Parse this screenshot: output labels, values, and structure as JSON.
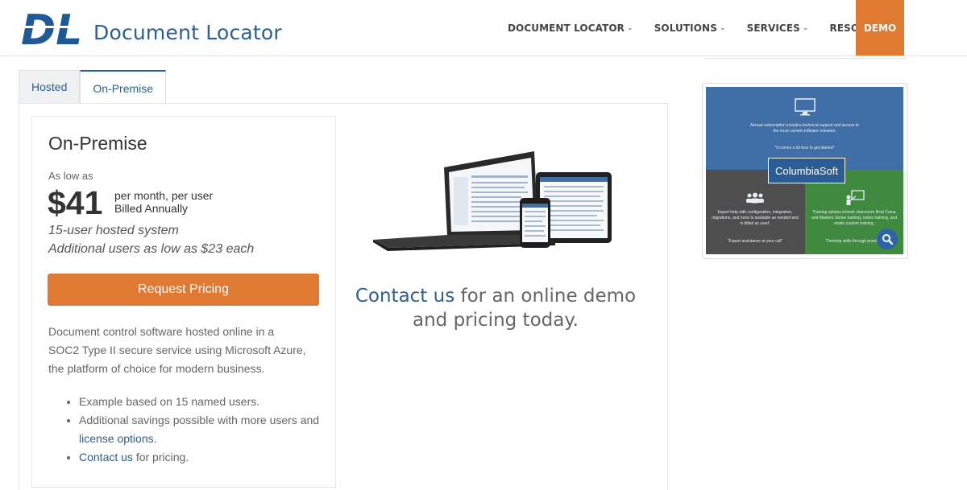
{
  "header": {
    "logo_mark": "DL",
    "logo_text": "Document Locator",
    "nav": [
      {
        "label": "DOCUMENT LOCATOR"
      },
      {
        "label": "SOLUTIONS"
      },
      {
        "label": "SERVICES"
      },
      {
        "label": "RESOURCES"
      }
    ],
    "demo_label": "DEMO"
  },
  "tabs": [
    {
      "label": "Hosted",
      "active": false
    },
    {
      "label": "On-Premise",
      "active": true
    }
  ],
  "card": {
    "title": "On-Premise",
    "as_low_as": "As low as",
    "price": "$41",
    "per_line1": "per month, per user",
    "per_line2": "Billed Annually",
    "hosted_note": "15-user hosted system",
    "additional_note": "Additional users as low as $23 each",
    "button_label": "Request Pricing",
    "description": "Document control software hosted online in a SOC2 Type II secure service using Microsoft Azure, the platform of choice for modern business.",
    "bullets": {
      "b1": "Example based on 15 named users.",
      "b2_text": "Additional savings possible with more users and ",
      "b2_link": "license options",
      "b2_end": ".",
      "b3_link": "Contact us",
      "b3_text": " for pricing."
    }
  },
  "middle": {
    "contact_link": "Contact us",
    "contact_text": " for an online demo and pricing today."
  },
  "banner": {
    "top_text": "Annual subscription includes technical support and access to the most current software releases.",
    "top_quote": "\"It comes a lot less to get started\"",
    "brand": "ColumbiaSoft",
    "left_text": "Expert help with configuration, integration, migrations, and more is available as needed and is billed as used.",
    "left_quote": "\"Expert assistance at your call\"",
    "right_text": "Training options include classroom Boot Camp and Masters Series training, online training, and onsite custom training.",
    "right_quote": "\"Develop skills through practice\""
  },
  "colors": {
    "brand_blue": "#2d5f8f",
    "accent_orange": "#e07a32"
  }
}
